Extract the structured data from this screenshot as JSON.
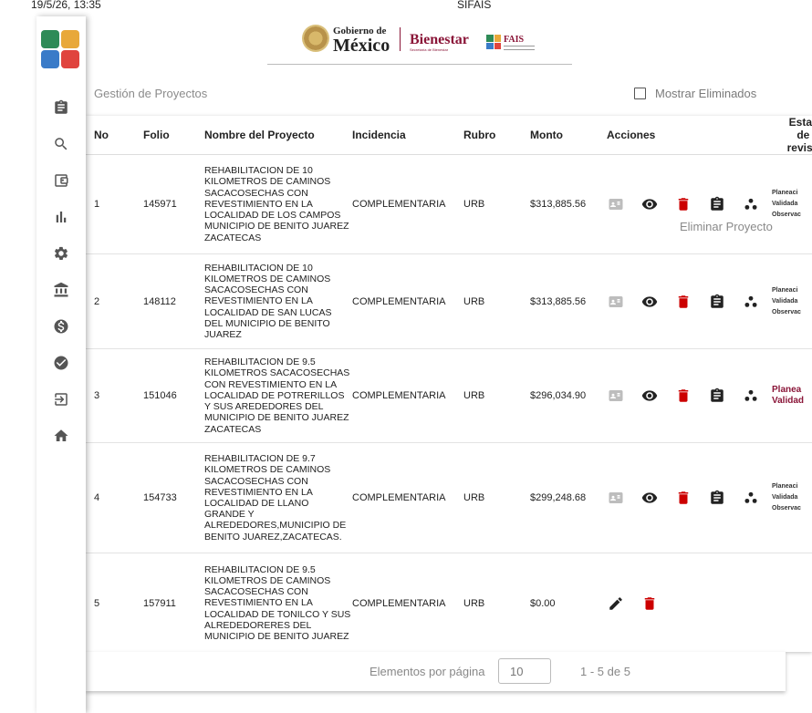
{
  "print_header": {
    "date": "19/5/26, 13:35",
    "site": "SIFAIS"
  },
  "header": {
    "gob_small": "Gobierno de",
    "gob_big": "México",
    "bienestar": "Bienestar",
    "bienestar_sub": "Secretaría de Bienestar",
    "fais": "FAIS"
  },
  "sidebar": {
    "items": [
      {
        "icon": "clipboard-icon"
      },
      {
        "icon": "search-icon"
      },
      {
        "icon": "wallet-icon"
      },
      {
        "icon": "bar-chart-icon"
      },
      {
        "icon": "gear-icon"
      },
      {
        "icon": "bank-icon"
      },
      {
        "icon": "dollar-icon"
      },
      {
        "icon": "check-circle-icon"
      },
      {
        "icon": "exit-icon"
      },
      {
        "icon": "home-icon"
      }
    ]
  },
  "page": {
    "title": "Gestión de Proyectos",
    "show_deleted_label": "Mostrar Eliminados"
  },
  "table": {
    "headers": {
      "no": "No",
      "folio": "Folio",
      "nombre": "Nombre del Proyecto",
      "incidencia": "Incidencia",
      "rubro": "Rubro",
      "monto": "Monto",
      "acciones": "Acciones",
      "estatus": "Estat\nde l\nrevisi"
    },
    "rows": [
      {
        "no": "1",
        "folio": "145971",
        "nombre": "REHABILITACION DE 10 KILOMETROS DE CAMINOS SACACOSECHAS CON REVESTIMIENTO EN LA LOCALIDAD DE LOS CAMPOS MUNICIPIO DE BENITO JUAREZ ZACATECAS",
        "incidencia": "COMPLEMENTARIA",
        "rubro": "URB",
        "monto": "$313,885.56",
        "estatus": "Planeaci\nValidada\nObservac"
      },
      {
        "no": "2",
        "folio": "148112",
        "nombre": "REHABILITACION DE 10 KILOMETROS DE CAMINOS SACACOSECHAS CON REVESTIMIENTO EN LA LOCALIDAD DE SAN LUCAS DEL MUNICIPIO DE BENITO JUAREZ",
        "incidencia": "COMPLEMENTARIA",
        "rubro": "URB",
        "monto": "$313,885.56",
        "estatus": "Planeaci\nValidada\nObservac"
      },
      {
        "no": "3",
        "folio": "151046",
        "nombre": "REHABILITACION DE 9.5 KILOMETROS SACACOSECHAS CON REVESTIMIENTO EN LA LOCALIDAD DE POTRERILLOS Y SUS AREDEDORES DEL MUNICIPIO DE BENITO JUAREZ ZACATECAS",
        "incidencia": "COMPLEMENTARIA",
        "rubro": "URB",
        "monto": "$296,034.90",
        "estatus": "Planea\nValidad"
      },
      {
        "no": "4",
        "folio": "154733",
        "nombre": "REHABILITACION DE 9.7 KILOMETROS DE CAMINOS SACACOSECHAS CON REVESTIMIENTO EN LA LOCALIDAD DE LLANO GRANDE Y ALREDEDORES,MUNICIPIO DE BENITO JUAREZ,ZACATECAS.",
        "incidencia": "COMPLEMENTARIA",
        "rubro": "URB",
        "monto": "$299,248.68",
        "estatus": "Planeaci\nValidada\nObservac"
      },
      {
        "no": "5",
        "folio": "157911",
        "nombre": "REHABILITACION DE 9.5 KILOMETROS DE CAMINOS SACACOSECHAS CON REVESTIMIENTO EN LA LOCALIDAD DE TONILCO Y SUS ALREDEDORERES DEL MUNICIPIO DE BENITO JUAREZ",
        "incidencia": "COMPLEMENTARIA",
        "rubro": "URB",
        "monto": "$0.00",
        "estatus": ""
      }
    ]
  },
  "tooltip": "Eliminar Proyecto",
  "paginator": {
    "label": "Elementos por página",
    "page_size": "10",
    "range": "1 - 5 de 5"
  },
  "colors": {
    "brand": "#8a1538",
    "action_icon": "#222222",
    "delete_icon": "#cc0000",
    "dim_icon": "#bdbdbd"
  }
}
